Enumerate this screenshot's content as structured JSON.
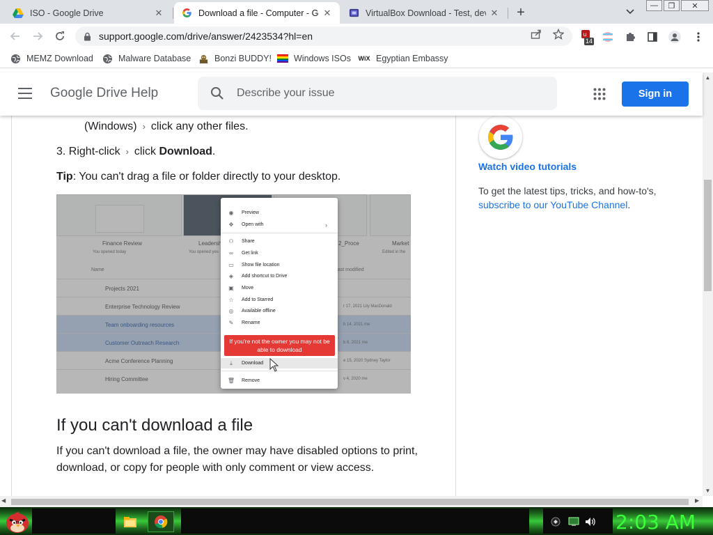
{
  "browser": {
    "tabs": [
      {
        "title": "ISO - Google Drive",
        "icon": "google-drive-icon",
        "active": false
      },
      {
        "title": "Download a file - Computer - Go",
        "icon": "google-g-icon",
        "active": true
      },
      {
        "title": "VirtualBox Download - Test, deve",
        "icon": "virtualbox-icon",
        "active": false
      }
    ],
    "url": "support.google.com/drive/answer/2423534?hl=en",
    "extension_badge": "14",
    "bookmarks": [
      {
        "label": "MEMZ Download",
        "icon": "globe-icon"
      },
      {
        "label": "Malware Database",
        "icon": "globe-icon"
      },
      {
        "label": "Bonzi BUDDY!",
        "icon": "bonzi-icon"
      },
      {
        "label": "Windows ISOs",
        "icon": "rainbow-flag-icon"
      },
      {
        "label": "Egyptian Embassy",
        "icon": "wix-icon"
      }
    ],
    "wix_glyph": "WiX"
  },
  "help": {
    "title": "Google Drive Help",
    "search_placeholder": "Describe your issue",
    "signin_label": "Sign in",
    "accent": "#1a73e8"
  },
  "article": {
    "line1_prefix": "(Windows)",
    "line1_suffix": "click any other files.",
    "step3_num": "3. Right-click",
    "step3_click": "click",
    "step3_bold": "Download",
    "step3_end": ".",
    "tip_label": "Tip",
    "tip_text": ": You can't drag a file or folder directly to your desktop.",
    "h2": "If you can't download a file",
    "para": "If you can't download a file, the owner may have disabled options to print, download, or copy for people with only comment or view access."
  },
  "screenshot": {
    "cards": [
      {
        "title": "Finance Review",
        "sub": "You opened today"
      },
      {
        "title": "Leadersh",
        "sub": "You opened yes"
      },
      {
        "title": "2_Proce",
        "sub": ""
      },
      {
        "title": "Market",
        "sub": "Edited in the"
      }
    ],
    "col_name": "Name",
    "col_modified": "Last modified",
    "rows": [
      {
        "name": "Projects 2021",
        "mod": "",
        "sel": false
      },
      {
        "name": "Enterprise Technology Review",
        "mod": "r 17, 2021 Lily MacDonald",
        "sel": false
      },
      {
        "name": "Team onboarding resources",
        "mod": "b 14, 2021 me",
        "sel": true
      },
      {
        "name": "Customer Outreach Research",
        "mod": "b 6, 2021 me",
        "sel": true
      },
      {
        "name": "Acme Conference Planning",
        "mod": "e 15, 2020 Sydney Taylor",
        "sel": false
      },
      {
        "name": "Hiring Committee",
        "mod": "v 4, 2020 me",
        "sel": false
      }
    ],
    "menu": [
      "Preview",
      "Open with",
      "Share",
      "Get link",
      "Show file location",
      "Add shortcut to Drive",
      "Move",
      "Add to Starred",
      "Available offline",
      "Rename",
      "Download",
      "Remove"
    ],
    "warning": "If you're not the owner you may not be able to download"
  },
  "sidebar": {
    "video_link": "Watch video tutorials",
    "text_prefix": "To get the latest tips, tricks, and how-to's,",
    "text_link": "subscribe to our YouTube Channel",
    "text_end": "."
  },
  "taskbar": {
    "clock": "2:03 AM"
  }
}
